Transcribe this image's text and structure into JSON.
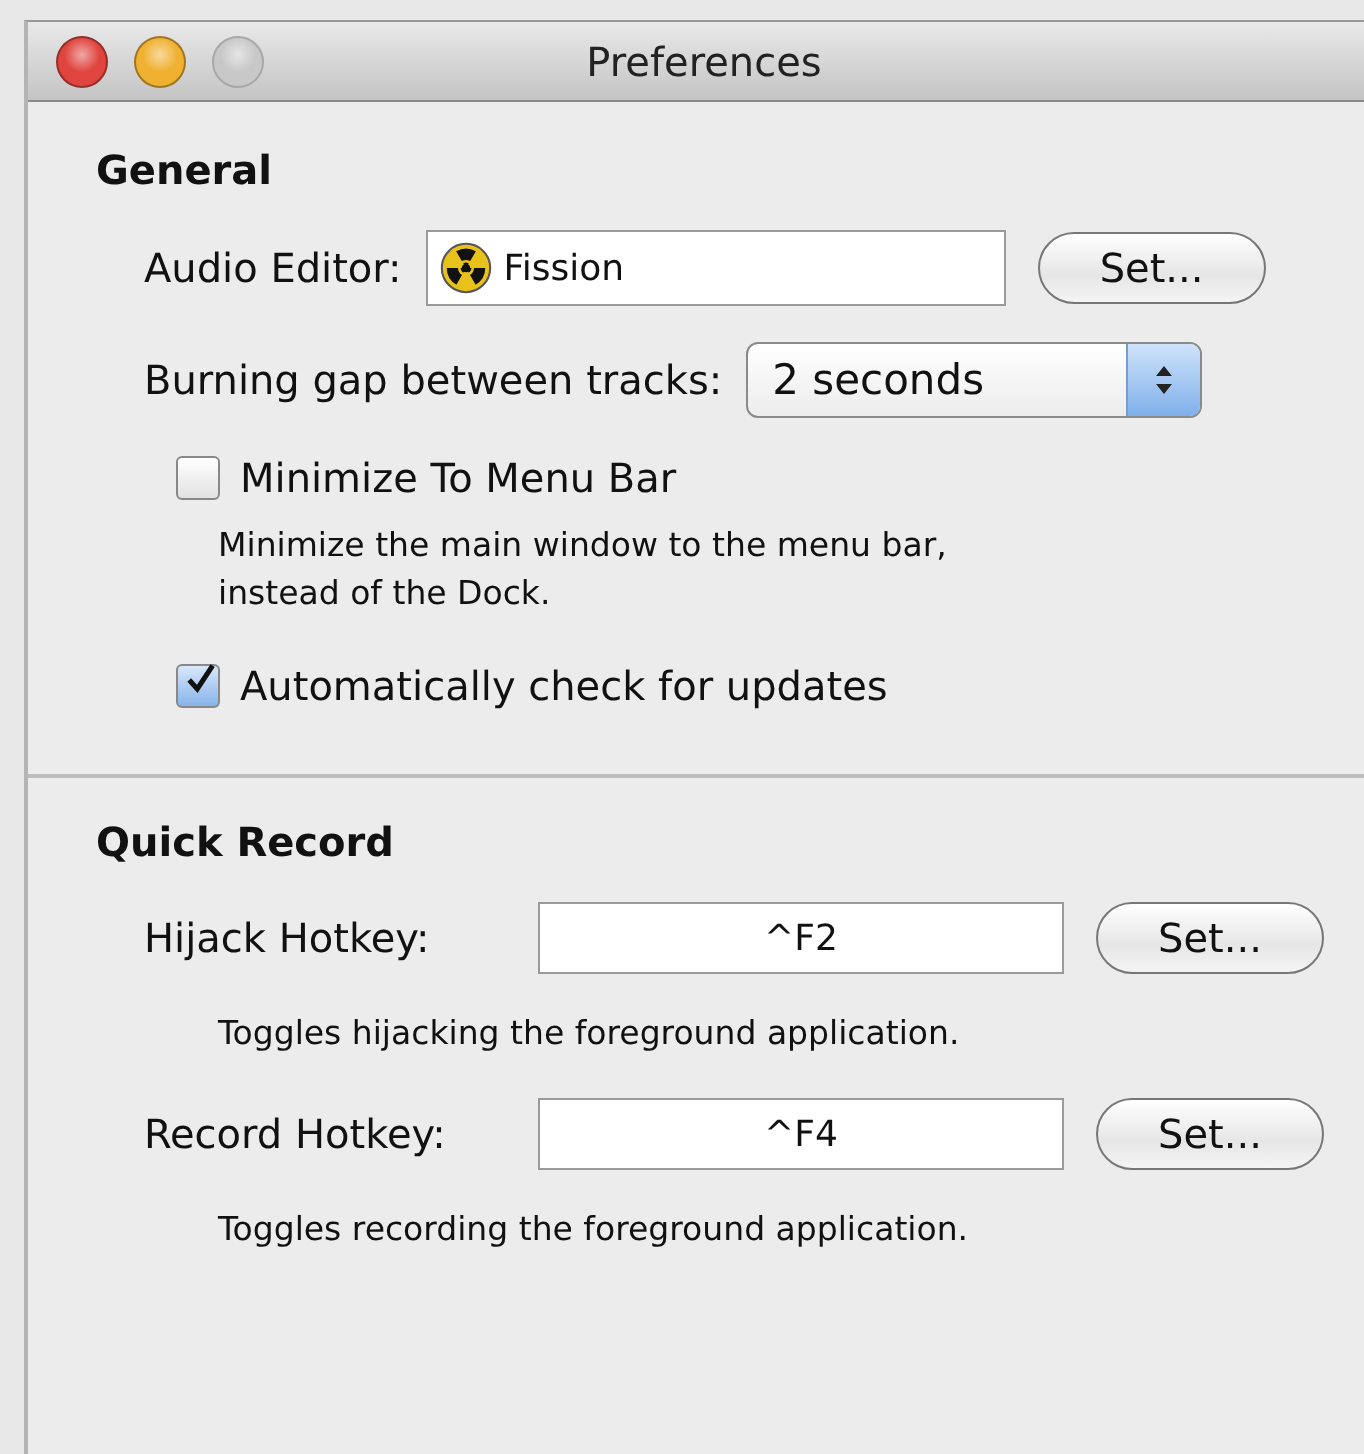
{
  "window": {
    "title": "Preferences",
    "controls": [
      {
        "kind": "close",
        "disabled": false
      },
      {
        "kind": "minimize",
        "disabled": false
      },
      {
        "kind": "zoom",
        "disabled": true
      }
    ]
  },
  "sections": [
    {
      "heading": "General",
      "rows": [
        {
          "kind": "app-field",
          "label": "Audio Editor:",
          "value": "Fission",
          "button": "Set..."
        },
        {
          "kind": "popup",
          "label": "Burning gap between tracks:",
          "value": "2 seconds"
        },
        {
          "kind": "checkbox",
          "label": "Minimize To Menu Bar",
          "checked": false,
          "description": "Minimize the main window to the menu bar,\ninstead of the Dock."
        },
        {
          "kind": "checkbox",
          "label": "Automatically check for updates",
          "checked": true
        }
      ]
    },
    {
      "heading": "Quick Record",
      "rows": [
        {
          "kind": "hotkey",
          "label": "Hijack Hotkey:",
          "value": "^F2",
          "button": "Set...",
          "description": "Toggles hijacking the foreground application."
        },
        {
          "kind": "hotkey",
          "label": "Record Hotkey:",
          "value": "^F4",
          "button": "Set...",
          "description": "Toggles recording the foreground application."
        }
      ]
    }
  ]
}
